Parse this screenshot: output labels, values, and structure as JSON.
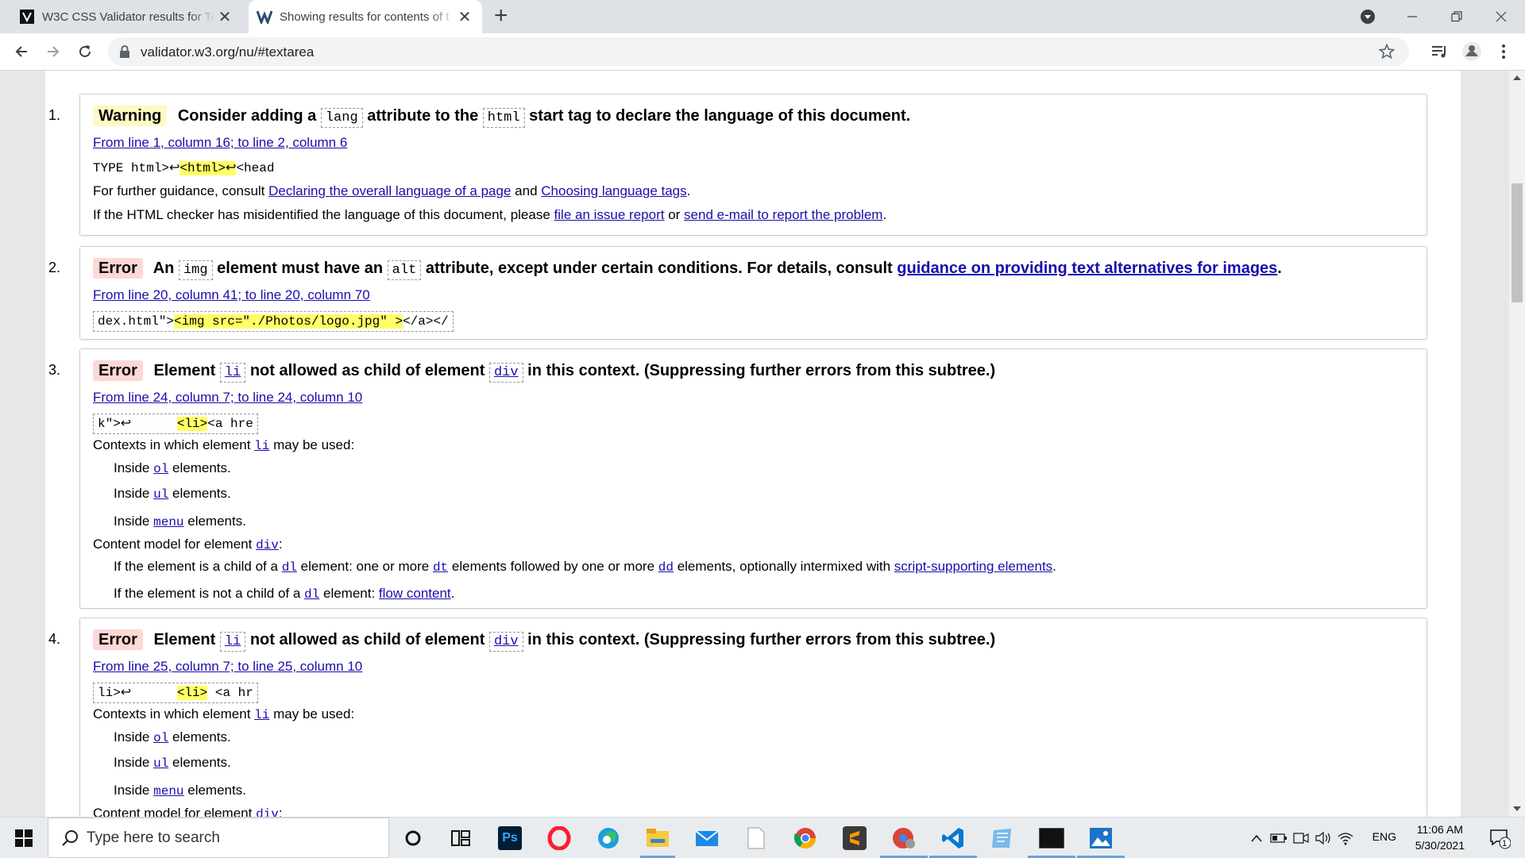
{
  "tabs": [
    {
      "title": "W3C CSS Validator results for Tex",
      "active": false
    },
    {
      "title": "Showing results for contents of t",
      "active": true
    }
  ],
  "address": {
    "url": "validator.w3.org/nu/#textarea"
  },
  "messages": [
    {
      "number": "1.",
      "type": "Warning",
      "title_parts": [
        "Consider adding a",
        "lang",
        "attribute to the",
        "html",
        "start tag to declare the language of this document."
      ],
      "location": "From line 1, column 16; to line 2, column 6",
      "extract": {
        "before": "TYPE html>↩",
        "highlight": "<html>↩",
        "after": "<head"
      },
      "guidance": {
        "prefix": "For further guidance, consult",
        "link1": "Declaring the overall language of a page",
        "and": "and",
        "link2": "Choosing language tags",
        "suffix": "."
      },
      "report": {
        "prefix": "If the HTML checker has misidentified the language of this document, please",
        "link1": "file an issue report",
        "or": "or",
        "link2": "send e-mail to report the problem",
        "suffix": "."
      }
    },
    {
      "number": "2.",
      "type": "Error",
      "title_parts": [
        "An",
        "img",
        "element must have an",
        "alt",
        "attribute, except under certain conditions. For details, consult",
        "guidance on providing text alternatives for images",
        "."
      ],
      "location": "From line 20, column 41; to line 20, column 70",
      "extract": {
        "before": "dex.html\">",
        "highlight": "<img src=\"./Photos/logo.jpg\" >",
        "after": "</a></"
      }
    },
    {
      "number": "3.",
      "type": "Error",
      "title_parts": [
        "Element",
        "li",
        "not allowed as child of element",
        "div",
        "in this context. (Suppressing further errors from this subtree.)"
      ],
      "location": "From line 24, column 7; to line 24, column 10",
      "extract": {
        "before": "k\">↩      ",
        "highlight": "<li>",
        "after": "<a hre"
      },
      "contexts_label": [
        "Contexts in which element",
        "li",
        "may be used:"
      ],
      "contexts": [
        {
          "pre": "Inside",
          "el": "ol",
          "post": "elements."
        },
        {
          "pre": "Inside",
          "el": "ul",
          "post": "elements."
        },
        {
          "pre": "Inside",
          "el": "menu",
          "post": "elements."
        }
      ],
      "content_model_label": [
        "Content model for element",
        "div",
        ":"
      ],
      "content_model": [
        {
          "t1": "If the element is a child of a",
          "el1": "dl",
          "t2": "element: one or more",
          "el2": "dt",
          "t3": "elements followed by one or more",
          "el3": "dd",
          "t4": "elements, optionally intermixed with",
          "link": "script-supporting elements",
          "t5": "."
        },
        {
          "t1": "If the element is not a child of a",
          "el1": "dl",
          "t2": "element:",
          "link": "flow content",
          "t3": "."
        }
      ]
    },
    {
      "number": "4.",
      "type": "Error",
      "title_parts": [
        "Element",
        "li",
        "not allowed as child of element",
        "div",
        "in this context. (Suppressing further errors from this subtree.)"
      ],
      "location": "From line 25, column 7; to line 25, column 10",
      "extract": {
        "before": "li>↩      ",
        "highlight": "<li>",
        "after": " <a hr"
      },
      "contexts_label": [
        "Contexts in which element",
        "li",
        "may be used:"
      ],
      "contexts": [
        {
          "pre": "Inside",
          "el": "ol",
          "post": "elements."
        },
        {
          "pre": "Inside",
          "el": "ul",
          "post": "elements."
        },
        {
          "pre": "Inside",
          "el": "menu",
          "post": "elements."
        }
      ],
      "content_model_label": [
        "Content model for element",
        "div",
        ":"
      ]
    }
  ],
  "taskbar": {
    "search_placeholder": "Type here to search",
    "language": "ENG",
    "time": "11:06 AM",
    "date": "5/30/2021",
    "notification_count": "1"
  },
  "colors": {
    "warning_badge": "#fff9c4",
    "error_badge": "#fdd8d6",
    "highlight": "#ffff66",
    "link": "#1a0dab"
  }
}
